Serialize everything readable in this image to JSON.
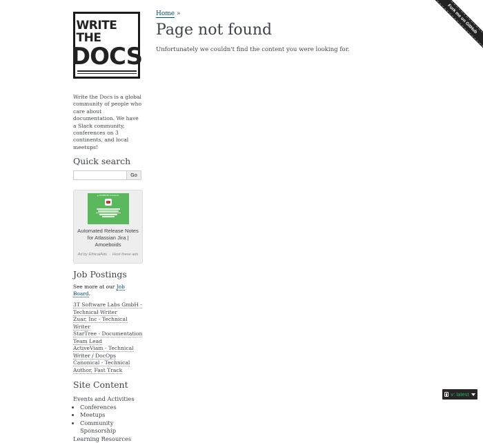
{
  "sidebar": {
    "logo": {
      "top": "WRITE THE",
      "bottom": "DOCS"
    },
    "blurb": "Write the Docs is a global community of people who care about documentation. We have a Slack community, conferences on 3 continents, and local meetups!",
    "quick_search": {
      "title": "Quick search",
      "input_value": "",
      "go_label": "Go"
    },
    "ad": {
      "image_topline": "▲ AMOEBOIDS     Amoeboids",
      "title": "Automated Release Notes for Atlassian Jira | Amoeboids",
      "by": "Ad by EthicalAds",
      "separator": "·",
      "host": "Host these ads"
    },
    "jobs": {
      "title": "Job Postings",
      "see_more_prefix": "See more at our ",
      "see_more_link": "Job Board",
      "see_more_suffix": ".",
      "items": [
        "3T Software Labs GmbH - Technical Writer",
        "Zuar, Inc - Technical Writer",
        "StarTree - Documentation Team Lead",
        "ActiveViam - Technical Writer / DocOps",
        "Canonical - Technical Author, Fast Track"
      ]
    },
    "site_content": {
      "title": "Site Content",
      "section1": "Events and Activities",
      "sub_items": [
        "Conferences",
        "Meetups",
        "Community Sponsorship"
      ],
      "section2": "Learning Resources"
    }
  },
  "main": {
    "breadcrumb_home": "Home",
    "breadcrumb_sep": "»",
    "title": "Page not found",
    "message": "Unfortunately we couldn't find the content you were looking for."
  },
  "ribbon": {
    "label": "Fork me on GitHub"
  },
  "version_badge": {
    "label": "v: latest"
  },
  "colors": {
    "link": "#004b6b",
    "text": "#3e4349",
    "ad_green": "#5cb85c",
    "badge_bg": "#272525",
    "badge_accent": "#27ae60"
  }
}
